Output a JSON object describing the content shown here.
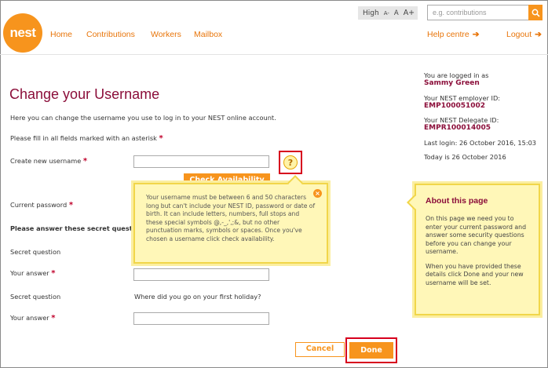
{
  "header": {
    "logo": "nest",
    "nav": [
      "Home",
      "Contributions",
      "Workers",
      "Mailbox"
    ],
    "help_label": "Help centre",
    "logout_label": "Logout",
    "text_size": {
      "label": "High",
      "small": "A-",
      "medium": "A",
      "large": "A+"
    },
    "search_placeholder": "e.g. contributions",
    "search_icon": "search-icon"
  },
  "main": {
    "title": "Change your Username",
    "intro": "Here you can change the username you use to log in to your NEST online account.",
    "required_note": "Please fill in all fields marked with an asterisk",
    "new_username_label": "Create new username",
    "check_availability_label": "Check Availability",
    "current_password_label": "Current password",
    "secret_questions_heading": "Please answer these secret questions.",
    "secret_question_label": "Secret question",
    "answer_label": "Your answer",
    "secret_question_2_text": "Where did you go on your first holiday?",
    "cancel_label": "Cancel",
    "done_label": "Done"
  },
  "tooltip": {
    "text": "Your username must be between 6 and 50 characters long but can't include your NEST ID, password or date of birth. It can include letters, numbers, full stops and these special symbols @,-_,',;&, but no other punctuation marks, symbols or spaces. Once you've chosen a username click check availability."
  },
  "sidebar": {
    "logged_in_label": "You are logged in as",
    "user_name": "Sammy Green",
    "employer_id_label": "Your NEST employer ID:",
    "employer_id": "EMP100051002",
    "delegate_id_label": "Your NEST Delegate ID:",
    "delegate_id": "EMPR100014005",
    "last_login": "Last login: 26 October 2016, 15:03",
    "today": "Today is 26 October 2016"
  },
  "about": {
    "title": "About this page",
    "p1": "On this page we need you to enter your current password and answer some security questions before you can change your username.",
    "p2": "When you have provided these details click Done and your new username will be set."
  },
  "colors": {
    "accent": "#f7941d",
    "title": "#8b0e3a",
    "tip_bg": "#fff7b8",
    "highlight": "#d7001d"
  }
}
